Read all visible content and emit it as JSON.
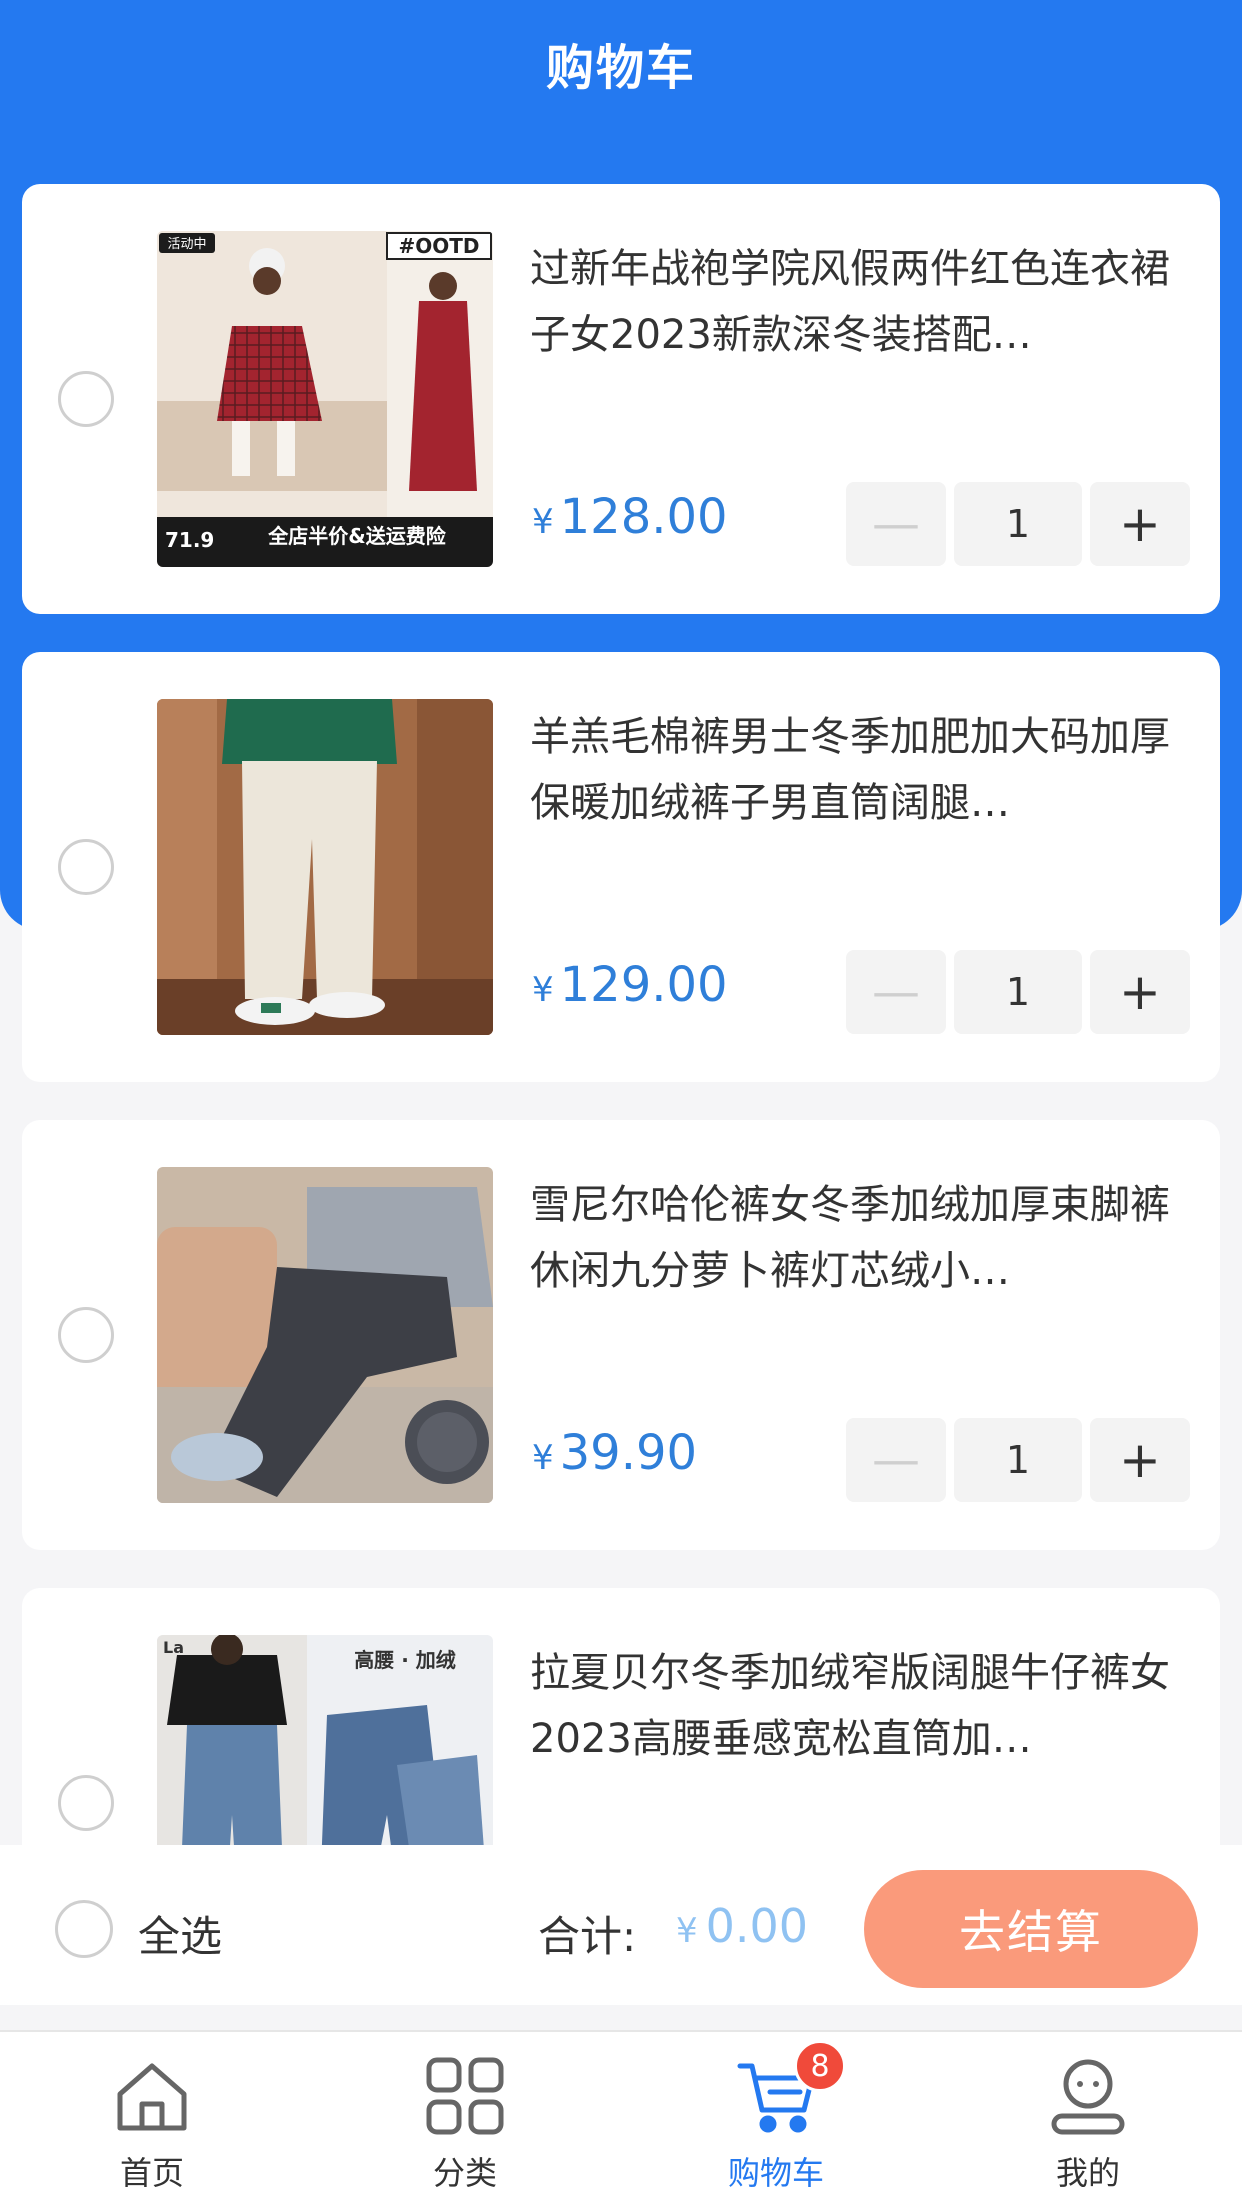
{
  "page": {
    "title": "购物车"
  },
  "cart": {
    "items": [
      {
        "title": "过新年战袍学院风假两件红色连衣裙子女2023新款深冬装搭配…",
        "currency": "¥",
        "price": "128.00",
        "quantity": "1",
        "minus": "—",
        "plus": "+"
      },
      {
        "title": "羊羔毛棉裤男士冬季加肥加大码加厚保暖加绒裤子男直筒阔腿…",
        "currency": "¥",
        "price": "129.00",
        "quantity": "1",
        "minus": "—",
        "plus": "+"
      },
      {
        "title": "雪尼尔哈伦裤女冬季加绒加厚束脚裤休闲九分萝卜裤灯芯绒小…",
        "currency": "¥",
        "price": "39.90",
        "quantity": "1",
        "minus": "—",
        "plus": "+"
      },
      {
        "title": "拉夏贝尔冬季加绒窄版阔腿牛仔裤女2023高腰垂感宽松直筒加…",
        "currency": "¥",
        "price": "",
        "quantity": "",
        "minus": "",
        "plus": ""
      }
    ],
    "image_text": {
      "promo_badge": "活动中",
      "ootd_tag": "#OOTD",
      "sale_price": "71.9",
      "promo_banner": "全店半价&送运费险",
      "jeans_tag": "高腰 · 加绒",
      "jeans_brand": "La"
    }
  },
  "footer": {
    "select_all_label": "全选",
    "total_label": "合计:",
    "total_currency": "¥",
    "total_value": "0.00",
    "checkout_label": "去结算"
  },
  "tabbar": {
    "tabs": [
      {
        "label": "首页",
        "icon": "home-icon"
      },
      {
        "label": "分类",
        "icon": "grid-icon"
      },
      {
        "label": "购物车",
        "icon": "cart-icon",
        "badge": "8",
        "active": true
      },
      {
        "label": "我的",
        "icon": "profile-icon"
      }
    ]
  },
  "colors": {
    "primary": "#2479f0",
    "price": "#2f7fd9",
    "checkout": "#fa9a7b",
    "badge": "#f04a3a"
  }
}
